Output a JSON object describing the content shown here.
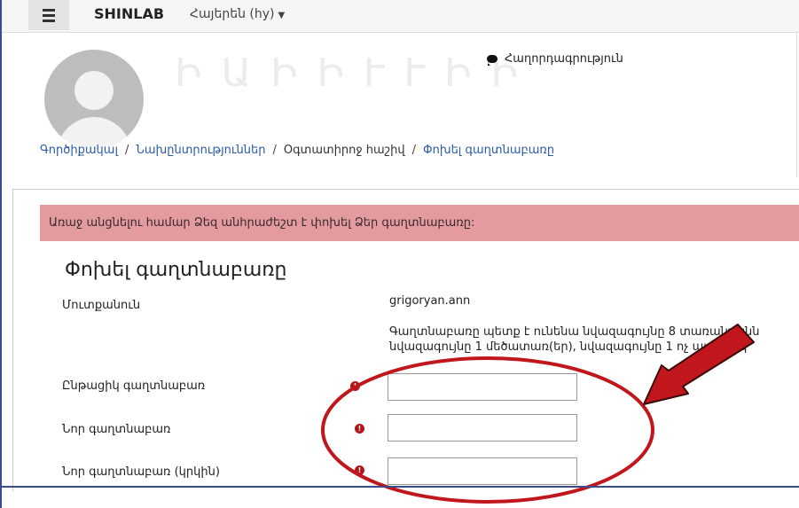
{
  "navbar": {
    "brand": "SHINLAB",
    "language": "Հայերեն (hy)"
  },
  "header": {
    "name": "Ի Ա Ի Ի Ւ Ւ Ի Ի",
    "messaging_label": "Հաղորդագրություն"
  },
  "breadcrumb": [
    "Գործիքակալ",
    "Նախընտրություններ",
    "Օգտատիրոջ հաշիվ",
    "Փոխել գաղտնաբառը"
  ],
  "alert_text": "Առաջ անցնելու համար Ձեզ անհրաժեշտ է փոխել Ձեր գաղտնաբառը:",
  "form": {
    "title": "Փոխել գաղտնաբառը",
    "username_label": "Մուտքանուն",
    "username_value": "grigoryan.ann",
    "policy_line1": "Գաղտնաբառը պետք է ունենա նվազագույնը 8 տառանշանն",
    "policy_line2": "նվազագույնը 1 մեծատառ(եր), նվազագույնը 1 ոչ այբենակ",
    "current_password_label": "Ընթացիկ գաղտնաբառ",
    "new_password_label": "Նոր գաղտնաբառ",
    "new_password_again_label": "Նոր գաղտնաբառ (կրկին)"
  },
  "colors": {
    "alert_bg": "#e39ba0",
    "annotation": "#c0161c",
    "required_icon": "#b2161b",
    "link": "#2a5aa8"
  }
}
